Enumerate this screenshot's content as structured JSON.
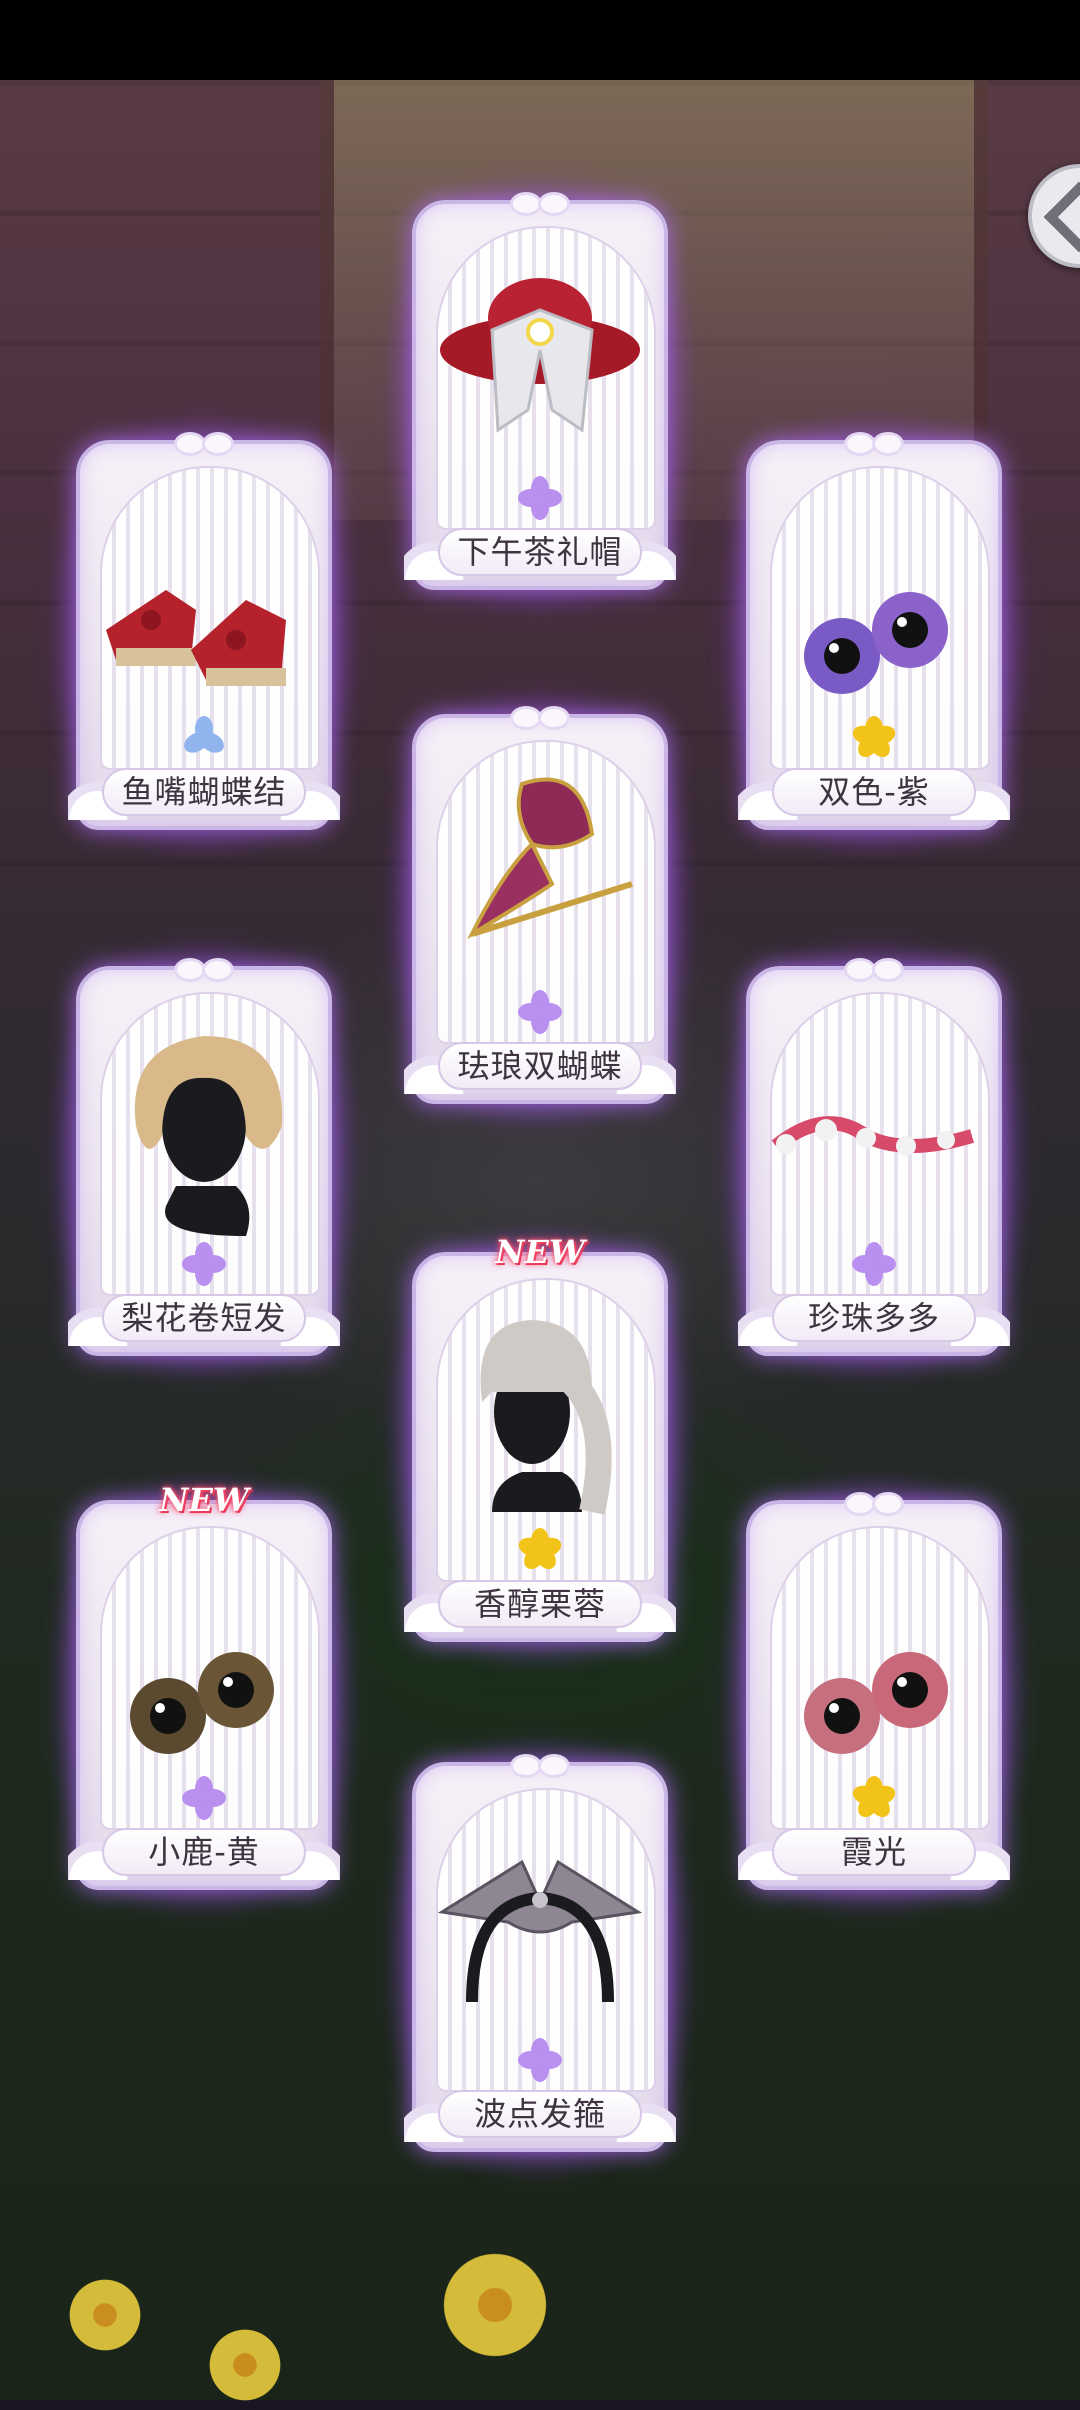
{
  "back_button": {
    "icon": "chevron-left-icon"
  },
  "items": [
    {
      "key": "shoes",
      "name": "鱼嘴蝴蝶结",
      "rarity": "blue",
      "is_new": false,
      "icon": "red-wedge-sandals-icon"
    },
    {
      "key": "hat",
      "name": "下午茶礼帽",
      "rarity": "purple",
      "is_new": false,
      "icon": "red-tea-hat-icon"
    },
    {
      "key": "eyes-purple",
      "name": "双色-紫",
      "rarity": "gold",
      "is_new": false,
      "icon": "purple-eyes-icon"
    },
    {
      "key": "butterfly-clip",
      "name": "珐琅双蝴蝶",
      "rarity": "purple",
      "is_new": false,
      "icon": "butterfly-hairpin-icon"
    },
    {
      "key": "short-hair",
      "name": "梨花卷短发",
      "rarity": "purple",
      "is_new": false,
      "icon": "blonde-short-hair-icon"
    },
    {
      "key": "pearl-ribbon",
      "name": "珍珠多多",
      "rarity": "purple",
      "is_new": false,
      "icon": "pearl-ribbon-icon"
    },
    {
      "key": "braid-hair",
      "name": "香醇栗蓉",
      "rarity": "gold",
      "is_new": true,
      "badge": "NEW",
      "icon": "silver-braid-hair-icon"
    },
    {
      "key": "eyes-brown",
      "name": "小鹿-黄",
      "rarity": "purple",
      "is_new": true,
      "badge": "NEW",
      "icon": "brown-eyes-icon"
    },
    {
      "key": "eyes-pink",
      "name": "霞光",
      "rarity": "gold",
      "is_new": false,
      "icon": "pink-eyes-icon"
    },
    {
      "key": "headband",
      "name": "波点发箍",
      "rarity": "purple",
      "is_new": false,
      "icon": "polka-dot-headband-icon"
    }
  ],
  "rarity_colors": {
    "blue": "#8fb4ee",
    "purple": "#b98ff0",
    "gold": "#f2c419"
  }
}
